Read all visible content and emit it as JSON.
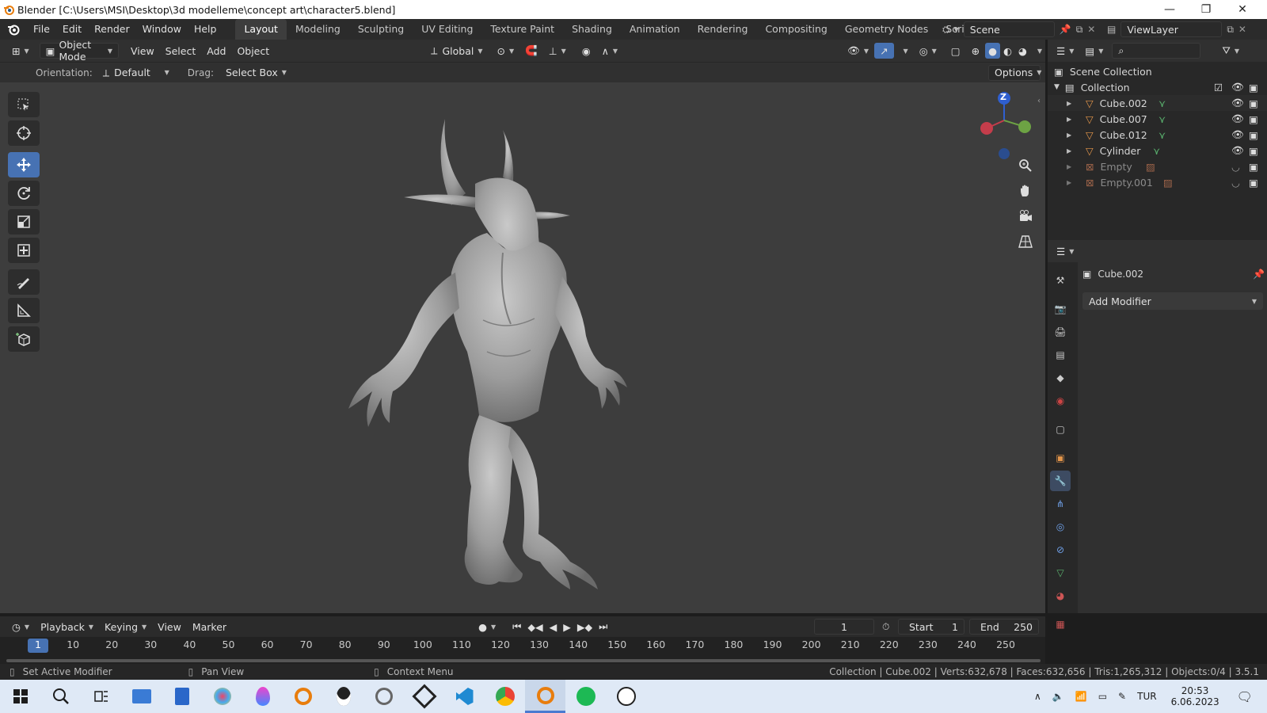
{
  "window": {
    "title": "Blender [C:\\Users\\MSI\\Desktop\\3d modelleme\\concept art\\character5.blend]"
  },
  "menu": {
    "items": [
      "File",
      "Edit",
      "Render",
      "Window",
      "Help"
    ]
  },
  "workspaces": {
    "active": "Layout",
    "tabs": [
      "Layout",
      "Modeling",
      "Sculpting",
      "UV Editing",
      "Texture Paint",
      "Shading",
      "Animation",
      "Rendering",
      "Compositing",
      "Geometry Nodes",
      "Scripting"
    ],
    "add": "+"
  },
  "scene": {
    "label": "Scene",
    "view_layer": "ViewLayer"
  },
  "viewport_header": {
    "mode": "Object Mode",
    "menus": [
      "View",
      "Select",
      "Add",
      "Object"
    ],
    "transform_orientation": "Global"
  },
  "tool_settings": {
    "orientation_label": "Orientation:",
    "orientation_value": "Default",
    "drag_label": "Drag:",
    "drag_value": "Select Box",
    "options": "Options"
  },
  "gizmo": {
    "z": "Z"
  },
  "outliner": {
    "scene_collection": "Scene Collection",
    "collection": "Collection",
    "items": [
      {
        "name": "Cube.002",
        "type": "mesh"
      },
      {
        "name": "Cube.007",
        "type": "mesh"
      },
      {
        "name": "Cube.012",
        "type": "mesh"
      },
      {
        "name": "Cylinder",
        "type": "mesh"
      },
      {
        "name": "Empty",
        "type": "empty"
      },
      {
        "name": "Empty.001",
        "type": "empty"
      }
    ]
  },
  "properties": {
    "object_name": "Cube.002",
    "add_modifier": "Add Modifier"
  },
  "timeline": {
    "menus": [
      "Playback",
      "Keying",
      "View",
      "Marker"
    ],
    "current_frame": "1",
    "start_label": "Start",
    "start": "1",
    "end_label": "End",
    "end": "250",
    "ticks": [
      "1",
      "10",
      "20",
      "30",
      "40",
      "50",
      "60",
      "70",
      "80",
      "90",
      "100",
      "110",
      "120",
      "130",
      "140",
      "150",
      "160",
      "170",
      "180",
      "190",
      "200",
      "210",
      "220",
      "230",
      "240",
      "250"
    ]
  },
  "status": {
    "left": "Set Active Modifier",
    "middle": "Pan View",
    "right_hint": "Context Menu",
    "stats": "Collection | Cube.002 | Verts:632,678 | Faces:632,656 | Tris:1,265,312 | Objects:0/4 | 3.5.1"
  },
  "taskbar": {
    "lang": "TUR",
    "time": "20:53",
    "date": "6.06.2023"
  },
  "colors": {
    "accent": "#4772b3",
    "mesh_icon": "#e3954a",
    "data_icon": "#5ab16e",
    "viewport": "#3d3d3d"
  }
}
